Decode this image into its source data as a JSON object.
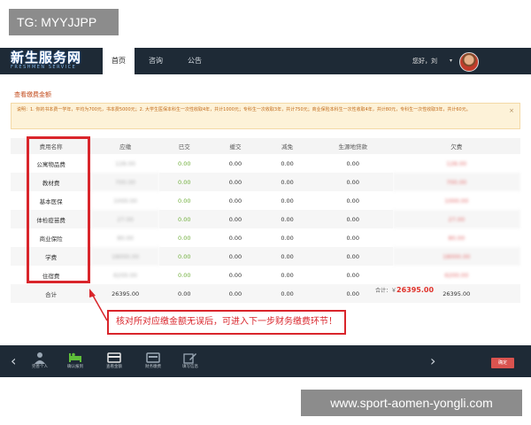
{
  "watermarks": {
    "top": "TG: MYYJJPP",
    "bottom": "www.sport-aomen-yongli.com"
  },
  "header": {
    "logo_main": "新生服务网",
    "logo_sub": "FRESHMEN SERVICE",
    "nav": [
      "首页",
      "咨询",
      "公告"
    ],
    "greeting": "您好，刘",
    "caret": "▾"
  },
  "page_title": "查看缴费金额",
  "notice": {
    "text": "说明：1. 你的书本费一学年，平均为700元，书本费5000元；2. 大学生医保本科生一次性收取4年，共计1000元；专科生一次收取3年，共计750元；商业保险本科生一次性收取4年，共计80元，专科生一次性收取3年，共计60元。",
    "close": "×"
  },
  "table": {
    "headers": [
      "费用名称",
      "应缴",
      "已交",
      "缓交",
      "减免",
      "生源地贷款",
      "欠费"
    ],
    "rows": [
      {
        "name": "公寓物品费",
        "due": "128.00",
        "paid": "0.00",
        "deferred": "0.00",
        "waived": "0.00",
        "loan": "0.00",
        "owed": "128.00"
      },
      {
        "name": "教材费",
        "due": "700.00",
        "paid": "0.00",
        "deferred": "0.00",
        "waived": "0.00",
        "loan": "0.00",
        "owed": "700.00"
      },
      {
        "name": "基本医保",
        "due": "1000.00",
        "paid": "0.00",
        "deferred": "0.00",
        "waived": "0.00",
        "loan": "0.00",
        "owed": "1000.00"
      },
      {
        "name": "体检疫苗费",
        "due": "27.00",
        "paid": "0.00",
        "deferred": "0.00",
        "waived": "0.00",
        "loan": "0.00",
        "owed": "27.00"
      },
      {
        "name": "商业保险",
        "due": "80.00",
        "paid": "0.00",
        "deferred": "0.00",
        "waived": "0.00",
        "loan": "0.00",
        "owed": "80.00"
      },
      {
        "name": "学费",
        "due": "18000.00",
        "paid": "0.00",
        "deferred": "0.00",
        "waived": "0.00",
        "loan": "0.00",
        "owed": "18000.00"
      },
      {
        "name": "住宿费",
        "due": "6200.00",
        "paid": "0.00",
        "deferred": "0.00",
        "waived": "0.00",
        "loan": "0.00",
        "owed": "6200.00"
      }
    ],
    "total": {
      "name": "合计",
      "due": "26395.00",
      "paid": "0.00",
      "deferred": "0.00",
      "waived": "0.00",
      "loan": "0.00",
      "owed": "26395.00"
    }
  },
  "total_label": "合计：￥",
  "total_amount": "26395.00",
  "callout": "核对所对应缴金额无误后，可进入下一步财务缴费环节！",
  "toolbar": {
    "items": [
      {
        "label": "完善个人",
        "icon": "person-icon"
      },
      {
        "label": "确认报到",
        "icon": "bed-icon"
      },
      {
        "label": "查看金额",
        "icon": "card-icon"
      },
      {
        "label": "财务缴费",
        "icon": "payment-icon"
      },
      {
        "label": "填写信息",
        "icon": "edit-icon"
      }
    ],
    "prev": "‹",
    "next": "›",
    "confirm": "确定"
  },
  "colors": {
    "header_bg": "#1e2a36",
    "accent_red": "#d9252b",
    "paid_green": "#6fae3a",
    "notice_bg": "#fdf2d8"
  }
}
